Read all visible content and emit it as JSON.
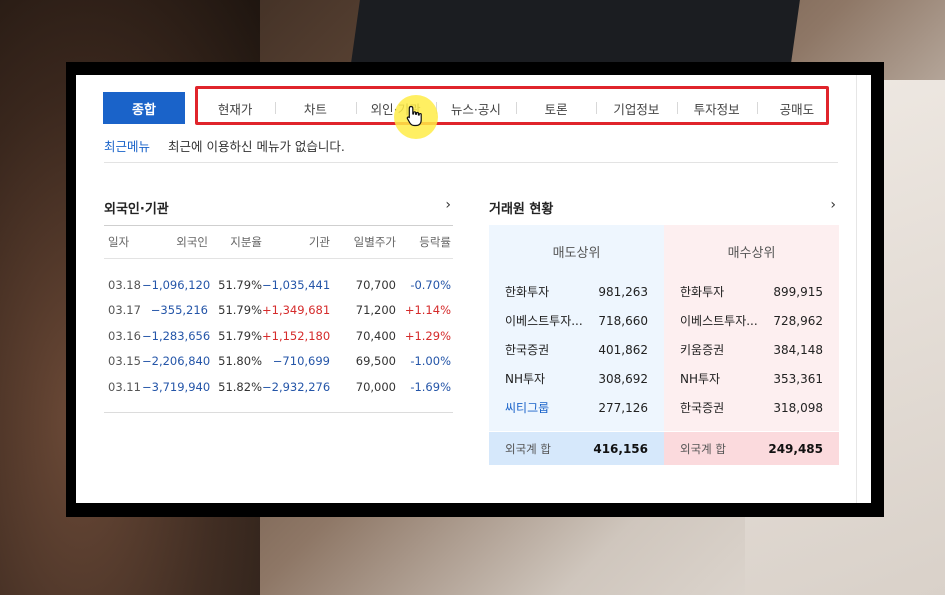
{
  "tabs": {
    "main": "종합",
    "items": [
      "현재가",
      "차트",
      "외인·기관",
      "뉴스·공시",
      "토론",
      "기업정보",
      "투자정보",
      "공매도"
    ]
  },
  "recent": {
    "label": "최근메뉴",
    "message": "최근에 이용하신 메뉴가 없습니다."
  },
  "foreign_institution": {
    "title": "외국인·기관",
    "columns": [
      "일자",
      "외국인",
      "지분율",
      "기관",
      "일별주가",
      "등락률"
    ],
    "rows": [
      [
        "03.18",
        "−1,096,120",
        "51.79%",
        "−1,035,441",
        "70,700",
        "-0.70%"
      ],
      [
        "03.17",
        "−355,216",
        "51.79%",
        "+1,349,681",
        "71,200",
        "+1.14%"
      ],
      [
        "03.16",
        "−1,283,656",
        "51.79%",
        "+1,152,180",
        "70,400",
        "+1.29%"
      ],
      [
        "03.15",
        "−2,206,840",
        "51.80%",
        "−710,699",
        "69,500",
        "-1.00%"
      ],
      [
        "03.11",
        "−3,719,940",
        "51.82%",
        "−2,932,276",
        "70,000",
        "-1.69%"
      ]
    ],
    "colors": {
      "negative": "#2455a8",
      "positive": "#d52b2b"
    }
  },
  "brokers": {
    "title": "거래원 현황",
    "sell": {
      "header": "매도상위",
      "items": [
        {
          "name": "한화투자",
          "value": "981,263"
        },
        {
          "name": "이베스트투자...",
          "value": "718,660"
        },
        {
          "name": "한국증권",
          "value": "401,862"
        },
        {
          "name": "NH투자",
          "value": "308,692"
        },
        {
          "name": "씨티그룹",
          "value": "277,126"
        }
      ],
      "foot_label": "외국계 합",
      "foot_value": "416,156"
    },
    "buy": {
      "header": "매수상위",
      "items": [
        {
          "name": "한화투자",
          "value": "899,915"
        },
        {
          "name": "이베스트투자...",
          "value": "728,962"
        },
        {
          "name": "키움증권",
          "value": "384,148"
        },
        {
          "name": "NH투자",
          "value": "353,361"
        },
        {
          "name": "한국증권",
          "value": "318,098"
        }
      ],
      "foot_label": "외국계 합",
      "foot_value": "249,485"
    }
  },
  "accent": "#1a63c9",
  "highlight": "#e0242b"
}
